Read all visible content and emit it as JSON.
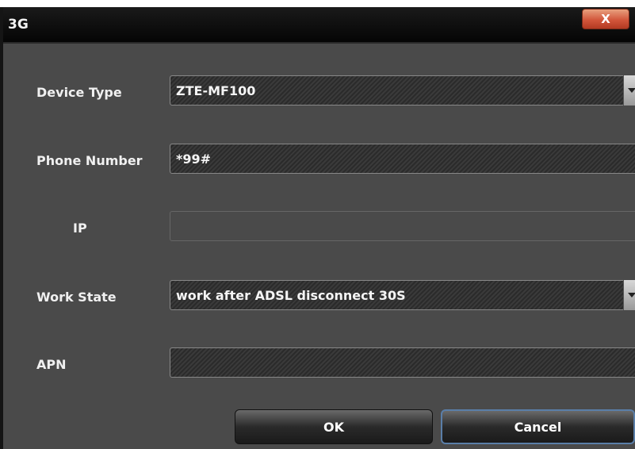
{
  "window": {
    "title": "3G",
    "close_label": "X"
  },
  "form": {
    "device_type": {
      "label": "Device Type",
      "value": "ZTE-MF100"
    },
    "phone_number": {
      "label": "Phone Number",
      "value": "*99#"
    },
    "ip": {
      "label": "IP",
      "value": ""
    },
    "work_state": {
      "label": "Work State",
      "value": "work after ADSL disconnect 30S"
    },
    "apn": {
      "label": "APN",
      "value": ""
    }
  },
  "buttons": {
    "ok": "OK",
    "cancel": "Cancel"
  }
}
